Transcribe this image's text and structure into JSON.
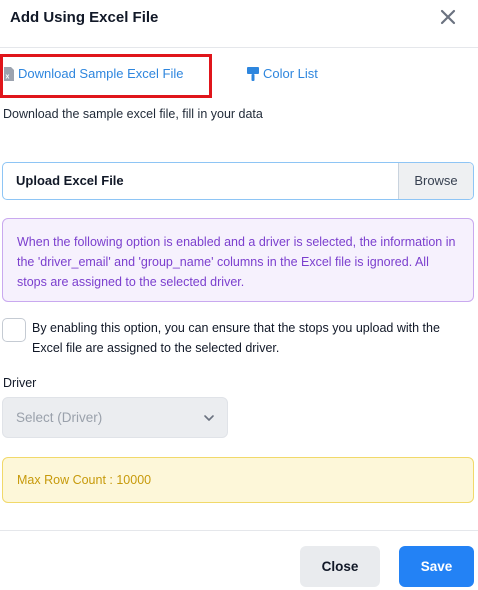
{
  "dialog": {
    "title": "Add Using Excel File",
    "close_icon": "close-icon"
  },
  "links": {
    "download_sample": "Download Sample Excel File",
    "download_icon": "excel-file-icon",
    "color_list": "Color List",
    "color_icon": "paint-brush-icon"
  },
  "instructions": "Download the sample excel file, fill in your data",
  "upload": {
    "label": "Upload Excel File",
    "browse_label": "Browse"
  },
  "info_note": "When the following option is enabled and a driver is selected, the information in the 'driver_email' and 'group_name' columns in the Excel file is ignored. All stops are assigned to the selected driver.",
  "assign_option": {
    "checked": false,
    "label": "By enabling this option, you can ensure that the stops you upload with the Excel file are assigned to the selected driver."
  },
  "driver": {
    "label": "Driver",
    "selected": "Select (Driver)",
    "disabled": true
  },
  "max_row_note": "Max Row Count : 10000",
  "footer": {
    "close_label": "Close",
    "save_label": "Save"
  },
  "colors": {
    "highlight": "#e0151b",
    "link": "#2e86de",
    "info_text": "#7b3fce",
    "warning_text": "#c79a0b",
    "primary": "#2382f5"
  }
}
